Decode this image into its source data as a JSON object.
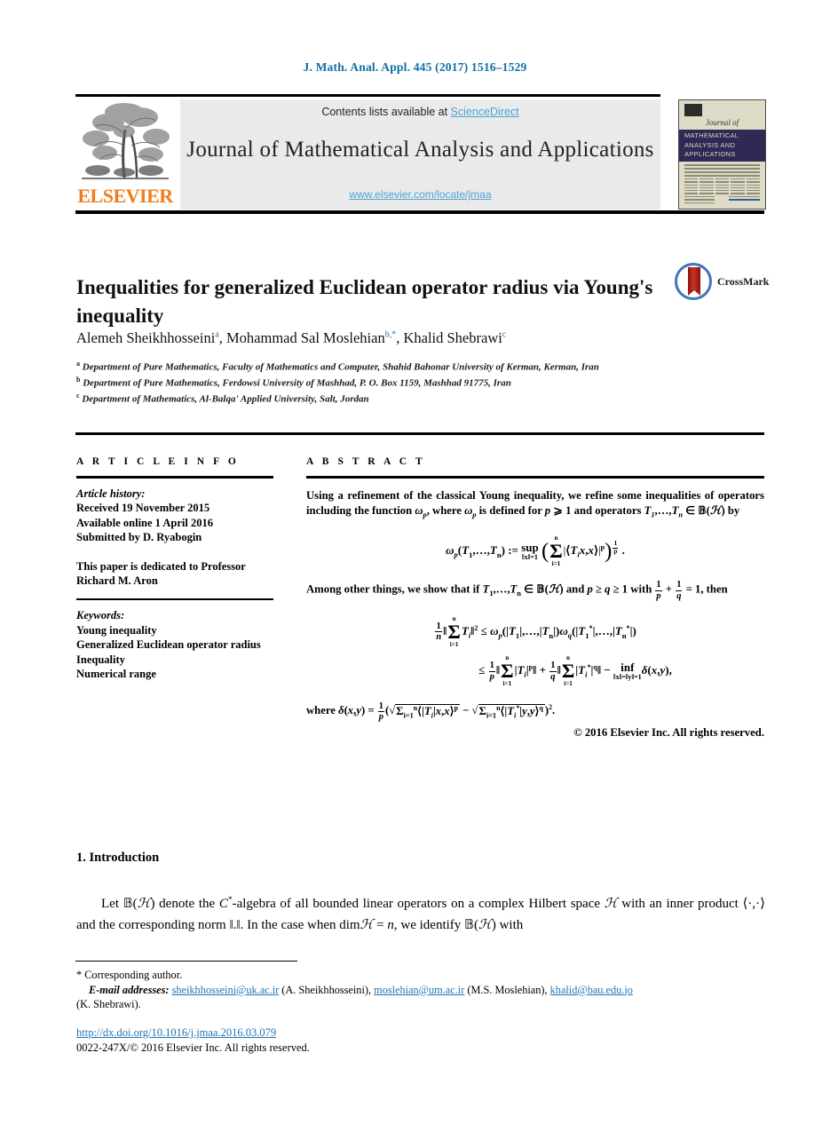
{
  "running_head": "J. Math. Anal. Appl. 445 (2017) 1516–1529",
  "masthead": {
    "contents_prefix": "Contents lists available at ",
    "sciencedirect": "ScienceDirect",
    "journal_title": "Journal of Mathematical Analysis and Applications",
    "journal_url": "www.elsevier.com/locate/jmaa",
    "publisher_wordmark": "ELSEVIER",
    "cover": {
      "journal_of": "Journal of",
      "band_title": "MATHEMATICAL ANALYSIS AND APPLICATIONS"
    }
  },
  "article": {
    "title": "Inequalities for generalized Euclidean operator radius via Young's inequality",
    "crossmark_label": "CrossMark",
    "authors": [
      {
        "name": "Alemeh Sheikhhosseini",
        "marks": "a"
      },
      {
        "name": "Mohammad Sal Moslehian",
        "marks": "b,*"
      },
      {
        "name": "Khalid Shebrawi",
        "marks": "c"
      }
    ],
    "affiliations": [
      {
        "mark": "a",
        "text": "Department of Pure Mathematics, Faculty of Mathematics and Computer, Shahid Bahonar University of Kerman, Kerman, Iran"
      },
      {
        "mark": "b",
        "text": "Department of Pure Mathematics, Ferdowsi University of Mashhad, P. O. Box 1159, Mashhad 91775, Iran"
      },
      {
        "mark": "c",
        "text": "Department of Mathematics, Al-Balqa' Applied University, Salt, Jordan"
      }
    ]
  },
  "article_info": {
    "heading": "A R T I C L E    I N F O",
    "history_label": "Article history:",
    "received": "Received 19 November 2015",
    "available_online": "Available online 1 April 2016",
    "submitted_by": "Submitted by D. Ryabogin",
    "dedication": "This paper is dedicated to Professor Richard M. Aron",
    "keywords_label": "Keywords:",
    "keywords": [
      "Young inequality",
      "Generalized Euclidean operator radius",
      "Inequality",
      "Numerical range"
    ]
  },
  "abstract": {
    "heading": "A B S T R A C T",
    "para1": "Using a refinement of the classical Young inequality, we refine some inequalities of operators including the function ω_p, where ω_p is defined for p ⩾ 1 and operators T_1,…,T_n ∈ 𝔹(ℋ) by",
    "equation1": "ω_p(T_1,…,T_n) := sup_{‖x‖=1} ( Σ_{i=1}^{n} |⟨T_i x, x⟩|^p )^{1/p} .",
    "para2": "Among other things, we show that if T_1,…,T_n ∈ 𝔹(ℋ) and p ≥ q ≥ 1 with 1/p + 1/q = 1, then",
    "equation2_line1": "(1/n)‖Σ_{i=1}^{n} T_i‖^2 ≤ ω_p(|T_1|,…,|T_n|) ω_q(|T_1*|,…,|T_n*|)",
    "equation2_line2": "≤ (1/p)‖Σ_{i=1}^{n}|T_i|^p‖ + (1/q)‖Σ_{i=1}^{n}|T_i*|^q‖ − inf_{‖x‖=‖y‖=1} δ(x,y),",
    "equation3": "where δ(x,y) = (1/p)(√(Σ_{i=1}^{n}⟨|T_i|x,x⟩^p) − √(Σ_{i=1}^{n}⟨|T_i*|y,y⟩^q))^2.",
    "copyright": "© 2016 Elsevier Inc. All rights reserved."
  },
  "introduction": {
    "heading": "1.  Introduction",
    "paragraph": "Let 𝔹(ℋ) denote the C*-algebra of all bounded linear operators on a complex Hilbert space ℋ with an inner product ⟨·,·⟩ and the corresponding norm ‖.‖. In the case when dim ℋ = n, we identify 𝔹(ℋ) with"
  },
  "footer": {
    "corresponding_author": "*  Corresponding author.",
    "email_label": "E-mail addresses:",
    "emails": [
      {
        "address": "sheikhhosseini@uk.ac.ir",
        "owner": "(A. Sheikhhosseini),"
      },
      {
        "address": "moslehian@um.ac.ir",
        "owner": "(M.S. Moslehian),"
      },
      {
        "address": "khalid@bau.edu.jo",
        "owner": ""
      }
    ],
    "email_tail": "(K. Shebrawi).",
    "doi": "http://dx.doi.org/10.1016/j.jmaa.2016.03.079",
    "issn_line": "0022-247X/© 2016 Elsevier Inc. All rights reserved."
  },
  "colors": {
    "link_blue": "#1f74b5",
    "sciencedirect_blue": "#4ea3d8",
    "elsevier_orange": "#ef7d1a",
    "cover_band": "#2e2a55",
    "cover_bg": "#dedcc6"
  }
}
